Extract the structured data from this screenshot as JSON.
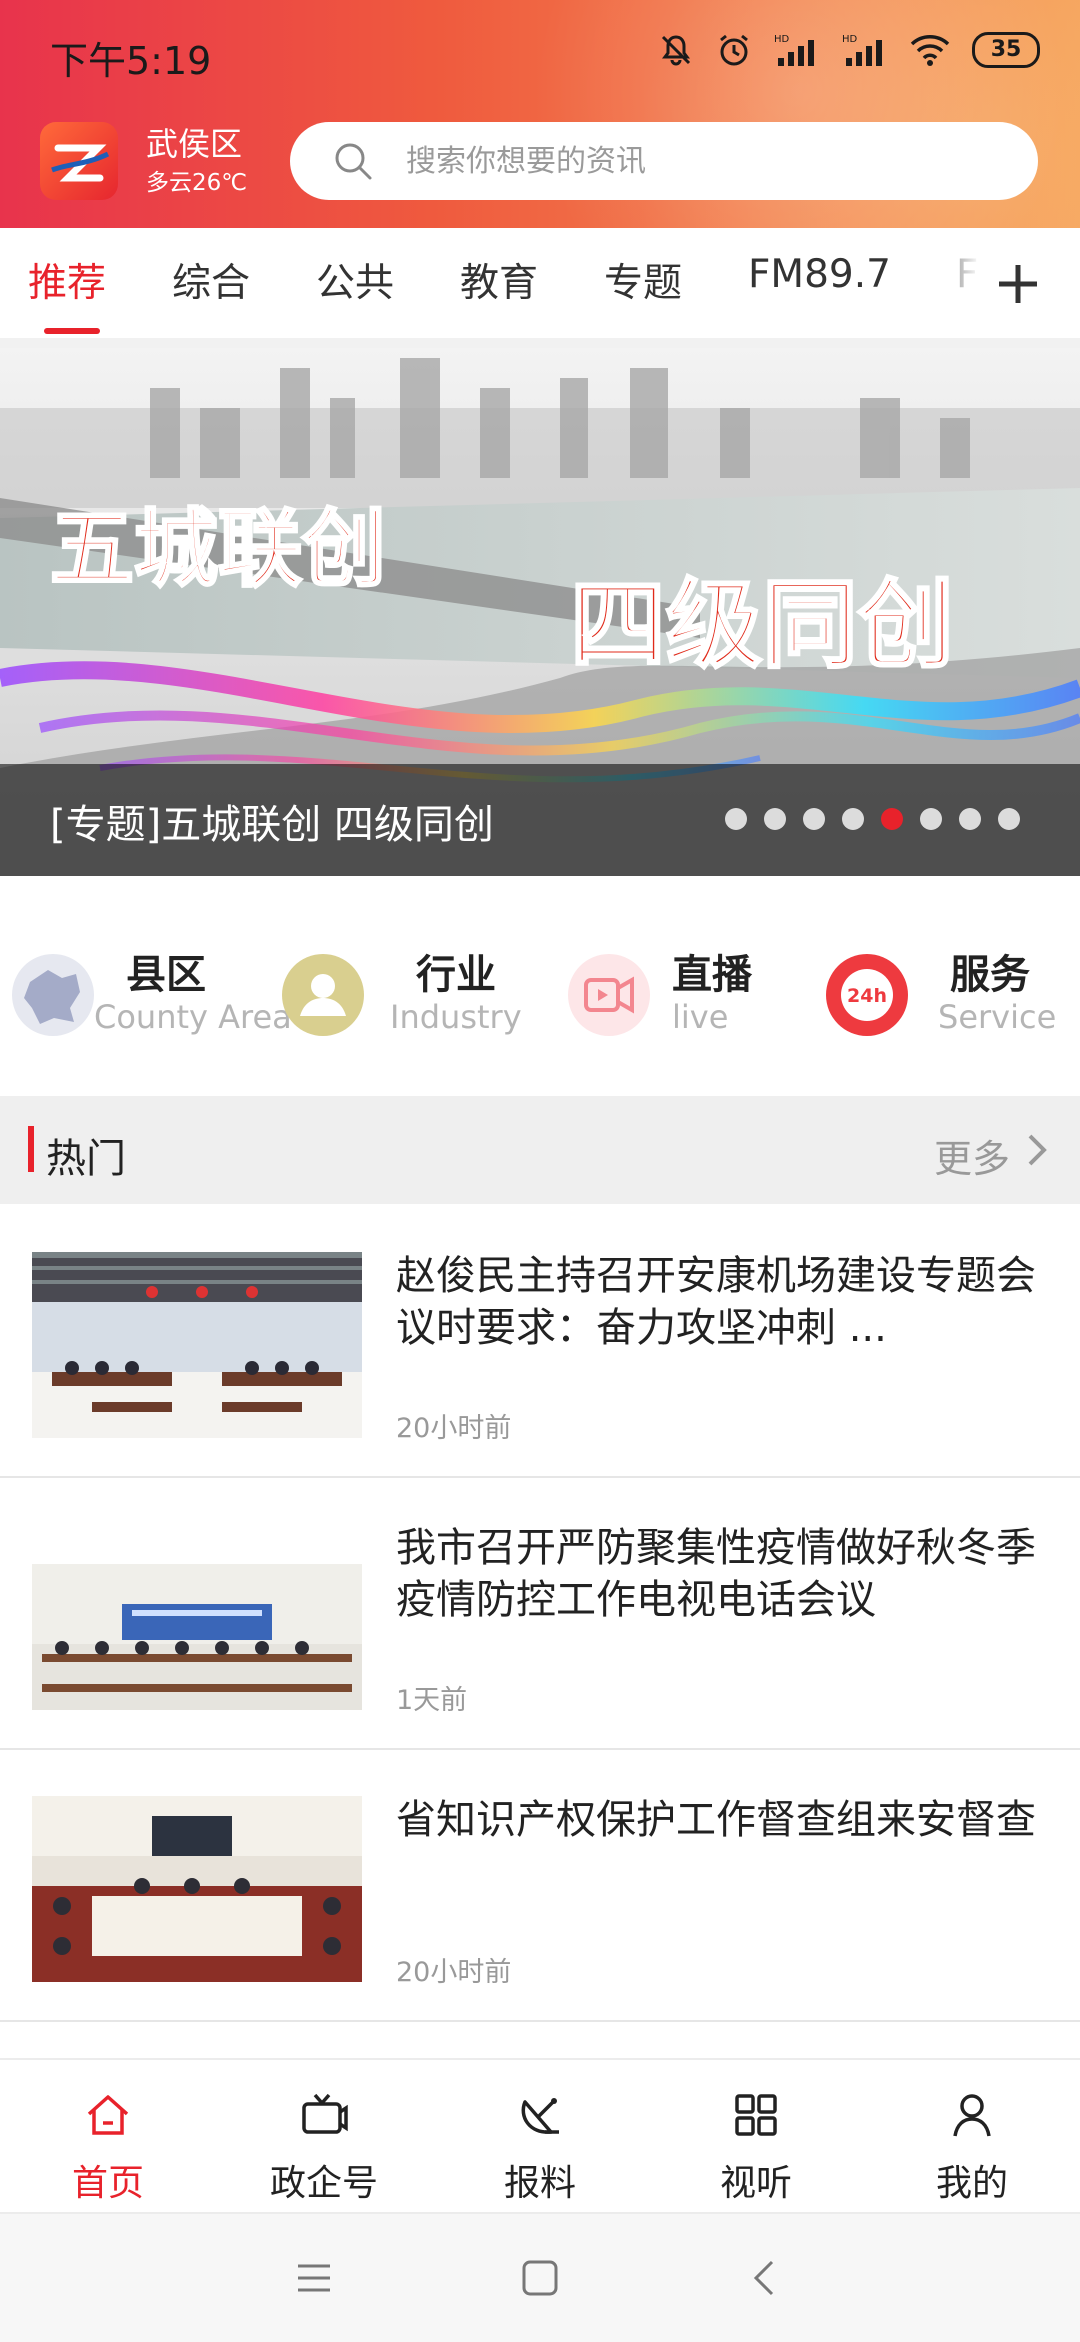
{
  "status_bar": {
    "time": "下午5:19",
    "battery": "35",
    "icons": [
      "mute-bell-icon",
      "alarm-icon",
      "hd-signal-icon",
      "hd-signal-icon",
      "wifi-icon",
      "battery-icon"
    ]
  },
  "header": {
    "location": "武侯区",
    "weather": "多云26℃",
    "search_placeholder": "搜索你想要的资讯"
  },
  "tabs": [
    "推荐",
    "综合",
    "公共",
    "教育",
    "专题",
    "FM89.7",
    "F"
  ],
  "active_tab": "推荐",
  "banner": {
    "caption": "[专题]五城联创 四级同创",
    "art_text_left": "五城联创",
    "art_text_right": "四级同创",
    "slide_count": 8,
    "active_slide": 5
  },
  "quick_links": [
    {
      "title": "县区",
      "subtitle": "County Area",
      "icon": "county-map-icon"
    },
    {
      "title": "行业",
      "subtitle": "Industry",
      "icon": "person-icon"
    },
    {
      "title": "直播",
      "subtitle": "live",
      "icon": "live-video-icon"
    },
    {
      "title": "服务",
      "subtitle": "Service",
      "icon": "24h-service-icon"
    }
  ],
  "hot_section": {
    "title": "热门",
    "more": "更多"
  },
  "news": [
    {
      "title": "赵俊民主持召开安康机场建设专题会议时要求：奋力攻坚冲刺 ...",
      "time": "20小时前"
    },
    {
      "title": "我市召开严防聚集性疫情做好秋冬季疫情防控工作电视电话会议",
      "time": "1天前"
    },
    {
      "title": "省知识产权保护工作督查组来安督查",
      "time": "20小时前"
    }
  ],
  "bottom_nav": [
    {
      "label": "首页",
      "icon": "home-icon"
    },
    {
      "label": "政企号",
      "icon": "tv-icon"
    },
    {
      "label": "报料",
      "icon": "satellite-dish-icon"
    },
    {
      "label": "视听",
      "icon": "grid-icon"
    },
    {
      "label": "我的",
      "icon": "user-icon"
    }
  ],
  "colors": {
    "accent": "#e8222b",
    "header_start": "#e8334c",
    "header_end": "#f5a05a"
  }
}
